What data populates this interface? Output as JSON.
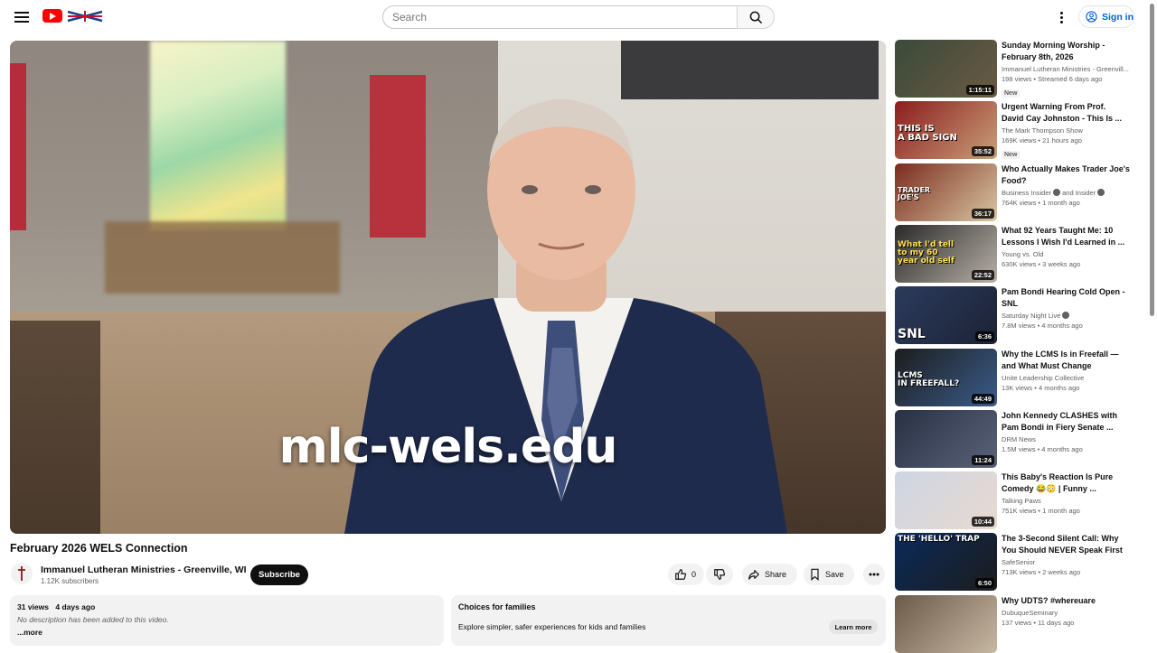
{
  "header": {
    "search_placeholder": "Search",
    "signin_label": "Sign in"
  },
  "player": {
    "caption": "mlc-wels.edu"
  },
  "video": {
    "title": "February 2026 WELS Connection",
    "channel": "Immanuel Lutheran Ministries - Greenville, WI",
    "subscribers": "1.12K subscribers",
    "subscribe_label": "Subscribe",
    "likes": "0",
    "share_label": "Share",
    "save_label": "Save"
  },
  "description": {
    "views": "31 views",
    "date": "4 days ago",
    "text": "No description has been added to this video.",
    "more_label": "...more"
  },
  "families": {
    "heading": "Choices for families",
    "text": "Explore simpler, safer experiences for kids and families",
    "learn_label": "Learn more"
  },
  "recommendations": [
    {
      "title": "Sunday Morning Worship - February 8th, 2026",
      "channel": "Immanuel Lutheran Ministries - Greenvill...",
      "meta": "198 views • Streamed 6 days ago",
      "duration": "1:15:11",
      "badge": "New",
      "thumb_text": "",
      "colors": [
        "#3a4a3a",
        "#6b5a44"
      ]
    },
    {
      "title": "Urgent Warning From Prof. David Cay Johnston - This Is ...",
      "channel": "The Mark Thompson Show",
      "meta": "169K views • 21 hours ago",
      "duration": "35:52",
      "badge": "New",
      "thumb_text": "THIS IS\nA BAD SIGN",
      "colors": [
        "#8b1d1d",
        "#c9a07a"
      ]
    },
    {
      "title": "Who Actually Makes Trader Joe's Food?",
      "channel": "Business Insider",
      "channel2": "and Insider",
      "meta": "764K views • 1 month ago",
      "duration": "36:17",
      "badge": "",
      "thumb_text": "TRADER\nJOE'S",
      "colors": [
        "#7b2b1e",
        "#d9c7a2"
      ]
    },
    {
      "title": "What 92 Years Taught Me: 10 Lessons I Wish I'd Learned in ...",
      "channel": "Young vs. Old",
      "meta": "630K views • 3 weeks ago",
      "duration": "22:52",
      "badge": "",
      "thumb_text": "What I'd tell\nto my 60\nyear old self",
      "colors": [
        "#2a2a2a",
        "#b7b0a6"
      ]
    },
    {
      "title": "Pam Bondi Hearing Cold Open - SNL",
      "channel": "Saturday Night Live",
      "meta": "7.8M views • 4 months ago",
      "duration": "6:36",
      "badge": "",
      "thumb_text": "SNL",
      "colors": [
        "#2c3b5c",
        "#1b2235"
      ]
    },
    {
      "title": "Why the LCMS Is in Freefall — and What Must Change",
      "channel": "Unite Leadership Collective",
      "meta": "13K views • 4 months ago",
      "duration": "44:49",
      "badge": "",
      "thumb_text": "LCMS\nIN FREEFALL?",
      "colors": [
        "#1d1d1d",
        "#3a5c8a"
      ]
    },
    {
      "title": "John Kennedy CLASHES with Pam Bondi in Fiery Senate ...",
      "channel": "DRM News",
      "meta": "1.5M views • 4 months ago",
      "duration": "11:24",
      "badge": "",
      "thumb_text": "",
      "colors": [
        "#283044",
        "#5a6478"
      ]
    },
    {
      "title": "This Baby's Reaction Is Pure Comedy 😂😳 | Funny ...",
      "channel": "Talking Paws",
      "meta": "751K views • 1 month ago",
      "duration": "10:44",
      "badge": "",
      "thumb_text": "",
      "colors": [
        "#cdd6e3",
        "#e8d9d0"
      ]
    },
    {
      "title": "The 3-Second Silent Call: Why You Should NEVER Speak First",
      "channel": "SafeSenior",
      "meta": "713K views • 2 weeks ago",
      "duration": "6:50",
      "badge": "",
      "thumb_text": "THE 'HELLO' TRAP",
      "colors": [
        "#0a2a5a",
        "#1c1c1c"
      ]
    },
    {
      "title": "Why UDTS? #whereuare",
      "channel": "DubuqueSeminary",
      "meta": "137 views • 11 days ago",
      "duration": "",
      "badge": "",
      "thumb_text": "",
      "colors": [
        "#6b5a48",
        "#c7b8a4"
      ]
    }
  ]
}
